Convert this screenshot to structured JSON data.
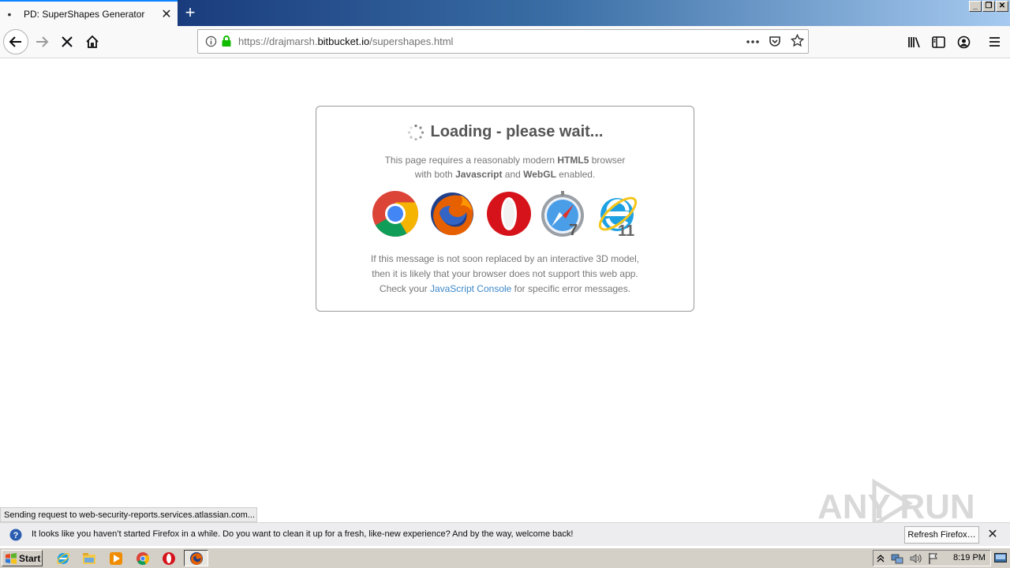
{
  "browser": {
    "tab_title": "PD: SuperShapes Generator",
    "tab_dot": "•",
    "tab_close": "✕",
    "new_tab": "+",
    "url_prefix": "https://drajmarsh.",
    "url_domain": "bitbucket.io",
    "url_path": "/supershapes.html",
    "window_controls": [
      "_",
      "❐",
      "✕"
    ]
  },
  "page": {
    "loading_title": "Loading - please wait...",
    "req_line1_a": "This page requires a reasonably modern ",
    "req_line1_b": "HTML5",
    "req_line1_c": " browser",
    "req_line2_a": "with both ",
    "req_line2_b": "Javascript",
    "req_line2_c": " and ",
    "req_line2_d": "WebGL",
    "req_line2_e": " enabled.",
    "browsers": [
      "chrome-icon",
      "firefox-icon",
      "opera-icon",
      "safari-icon",
      "ie-icon"
    ],
    "safari_version": "7",
    "ie_version": "11",
    "note_line1": "If this message is not soon replaced by an interactive 3D model,",
    "note_line2": "then it is likely that your browser does not support this web app.",
    "note_line3_a": "Check your ",
    "note_line3_link": "JavaScript Console",
    "note_line3_b": " for specific error messages."
  },
  "status": {
    "text": "Sending request to web-security-reports.services.atlassian.com..."
  },
  "notification": {
    "text": "It looks like you haven’t started Firefox in a while. Do you want to clean it up for a fresh, like-new experience? And by the way, welcome back!",
    "button": "Refresh Firefox…",
    "close": "✕"
  },
  "taskbar": {
    "start": "Start",
    "clock": "8:19 PM"
  },
  "watermark": {
    "text": "ANY RUN"
  },
  "colors": {
    "link": "#3b87c8",
    "accent": "#0a84ff",
    "lock": "#12bc00"
  }
}
